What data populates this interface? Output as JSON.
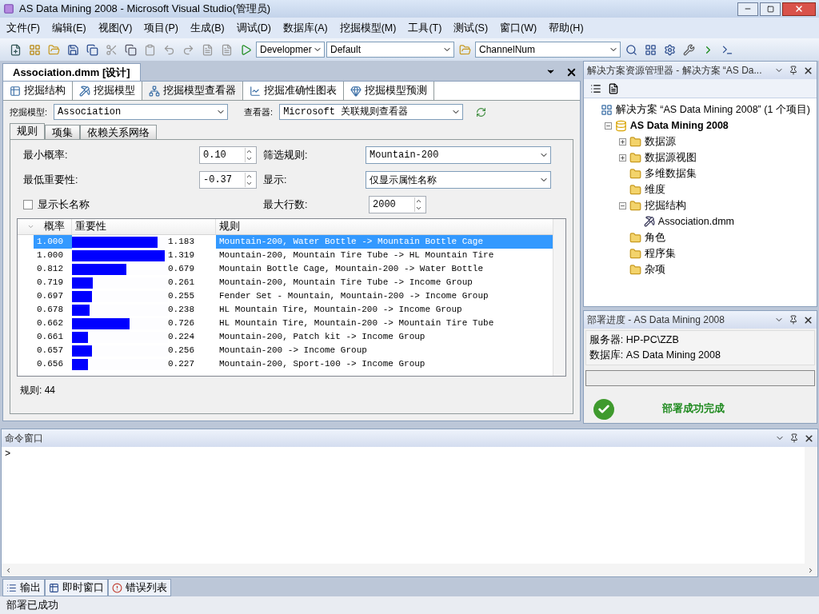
{
  "window": {
    "title": "AS Data Mining 2008 - Microsoft Visual Studio(管理员)"
  },
  "menu": [
    "文件(F)",
    "编辑(E)",
    "视图(V)",
    "项目(P)",
    "生成(B)",
    "调试(D)",
    "数据库(A)",
    "挖掘模型(M)",
    "工具(T)",
    "测试(S)",
    "窗口(W)",
    "帮助(H)"
  ],
  "toolbar": {
    "configuration": "Developmer",
    "platform": "Default",
    "find": "ChannelNum"
  },
  "document": {
    "tab": "Association.dmm [设计]",
    "designer_tabs": [
      {
        "label": "挖掘结构",
        "selected": false
      },
      {
        "label": "挖掘模型",
        "selected": false
      },
      {
        "label": "挖掘模型查看器",
        "selected": true
      },
      {
        "label": "挖掘准确性图表",
        "selected": false
      },
      {
        "label": "挖掘模型预测",
        "selected": false
      }
    ],
    "model_label": "挖掘模型:",
    "model": "Association",
    "viewer_label": "查看器:",
    "viewer": "Microsoft 关联规则查看器",
    "viewer_tabs": [
      {
        "label": "规则",
        "selected": true
      },
      {
        "label": "项集",
        "selected": false
      },
      {
        "label": "依赖关系网络",
        "selected": false
      }
    ],
    "min_probability": {
      "label": "最小概率:",
      "value": "0.10"
    },
    "min_importance": {
      "label": "最低重要性:",
      "value": "-0.37"
    },
    "show_long_names": {
      "label": "显示长名称",
      "checked": false
    },
    "filter_rule": {
      "label": "筛选规则:",
      "value": "Mountain-200"
    },
    "display": {
      "label": "显示:",
      "value": "仅显示属性名称"
    },
    "max_rows": {
      "label": "最大行数:",
      "value": "2000"
    },
    "columns": [
      "概率",
      "重要性",
      "规则"
    ],
    "rows": [
      {
        "probability": "1.000",
        "importance": "1.183",
        "level": 0.89,
        "rule": "Mountain-200, Water Bottle -> Mountain Bottle Cage",
        "selected": true
      },
      {
        "probability": "1.000",
        "importance": "1.319",
        "level": 0.97,
        "rule": "Mountain-200, Mountain Tire Tube -> HL Mountain Tire",
        "selected": false
      },
      {
        "probability": "0.812",
        "importance": "0.679",
        "level": 0.57,
        "rule": "Mountain Bottle Cage, Mountain-200 -> Water Bottle",
        "selected": false
      },
      {
        "probability": "0.719",
        "importance": "0.261",
        "level": 0.22,
        "rule": "Mountain-200, Mountain Tire Tube -> Income Group",
        "selected": false
      },
      {
        "probability": "0.697",
        "importance": "0.255",
        "level": 0.21,
        "rule": "Fender Set - Mountain, Mountain-200 -> Income Group",
        "selected": false
      },
      {
        "probability": "0.678",
        "importance": "0.238",
        "level": 0.18,
        "rule": "HL Mountain Tire, Mountain-200 -> Income Group",
        "selected": false
      },
      {
        "probability": "0.662",
        "importance": "0.726",
        "level": 0.6,
        "rule": "HL Mountain Tire, Mountain-200 -> Mountain Tire Tube",
        "selected": false
      },
      {
        "probability": "0.661",
        "importance": "0.224",
        "level": 0.17,
        "rule": "Mountain-200, Patch kit -> Income Group",
        "selected": false
      },
      {
        "probability": "0.657",
        "importance": "0.256",
        "level": 0.21,
        "rule": "Mountain-200 -> Income Group",
        "selected": false
      },
      {
        "probability": "0.656",
        "importance": "0.227",
        "level": 0.17,
        "rule": "Mountain-200, Sport-100 -> Income Group",
        "selected": false
      }
    ],
    "rule_count": "规则: 44"
  },
  "solution_explorer": {
    "title": "解决方案资源管理器 - 解决方案 “AS Da...",
    "tree": [
      {
        "label": "解决方案 “AS Data Mining 2008” (1 个项目)",
        "kind": "solution",
        "children": [
          {
            "label": "AS Data Mining 2008",
            "kind": "project",
            "expanded": true,
            "children": [
              {
                "label": "数据源",
                "kind": "folder",
                "expanded": false
              },
              {
                "label": "数据源视图",
                "kind": "folder",
                "expanded": false
              },
              {
                "label": "多维数据集",
                "kind": "folder"
              },
              {
                "label": "维度",
                "kind": "folder"
              },
              {
                "label": "挖掘结构",
                "kind": "folder",
                "expanded": true,
                "children": [
                  {
                    "label": "Association.dmm",
                    "kind": "model"
                  }
                ]
              },
              {
                "label": "角色",
                "kind": "folder"
              },
              {
                "label": "程序集",
                "kind": "folder"
              },
              {
                "label": "杂项",
                "kind": "folder"
              }
            ]
          }
        ]
      }
    ]
  },
  "deployment": {
    "title": "部署进度 - AS Data Mining 2008",
    "server": "服务器: HP-PC\\ZZB",
    "database": "数据库: AS Data Mining 2008",
    "result": "部署成功完成"
  },
  "command_window": {
    "title": "命令窗口",
    "prompt": ">"
  },
  "bottom_tabs": [
    "输出",
    "即时窗口",
    "错误列表"
  ],
  "status_bar": "部署已成功"
}
